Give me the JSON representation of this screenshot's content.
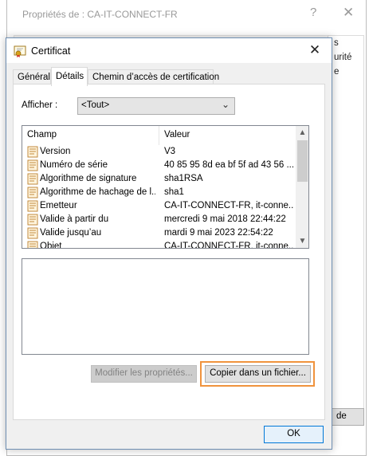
{
  "background_dialog": {
    "title": "Propriétés de : CA-IT-CONNECT-FR",
    "help_glyph": "?",
    "close_glyph": "✕",
    "right_texts": [
      "s",
      "urité",
      "e"
    ],
    "right_button_label": "de"
  },
  "certificate_dialog": {
    "title": "Certificat",
    "close_glyph": "✕",
    "tabs": [
      {
        "label": "Général",
        "active": false
      },
      {
        "label": "Détails",
        "active": true
      },
      {
        "label": "Chemin d’accès de certification",
        "active": false
      }
    ],
    "show_label": "Afficher :",
    "show_value": "<Tout>",
    "columns": {
      "field": "Champ",
      "value": "Valeur"
    },
    "rows": [
      {
        "field": "Version",
        "value": "V3"
      },
      {
        "field": "Numéro de série",
        "value": "40 85 95 8d ea bf 5f ad 43 56 ..."
      },
      {
        "field": "Algorithme de signature",
        "value": "sha1RSA"
      },
      {
        "field": "Algorithme de hachage de l...",
        "value": "sha1"
      },
      {
        "field": "Émetteur",
        "value": "CA-IT-CONNECT-FR, it-conne..."
      },
      {
        "field": "Valide à partir du",
        "value": "mercredi 9 mai 2018 22:44:22"
      },
      {
        "field": "Valide jusqu’au",
        "value": "mardi 9 mai 2023 22:54:22"
      },
      {
        "field": "Objet",
        "value": "CA-IT-CONNECT-FR, it-conne..."
      }
    ],
    "edit_properties_label": "Modifier les propriétés...",
    "copy_to_file_label": "Copier dans un fichier...",
    "ok_label": "OK"
  },
  "colors": {
    "accent": "#0078d7",
    "highlight": "#f0933d",
    "cert_icon_gold": "#d9a21b"
  }
}
